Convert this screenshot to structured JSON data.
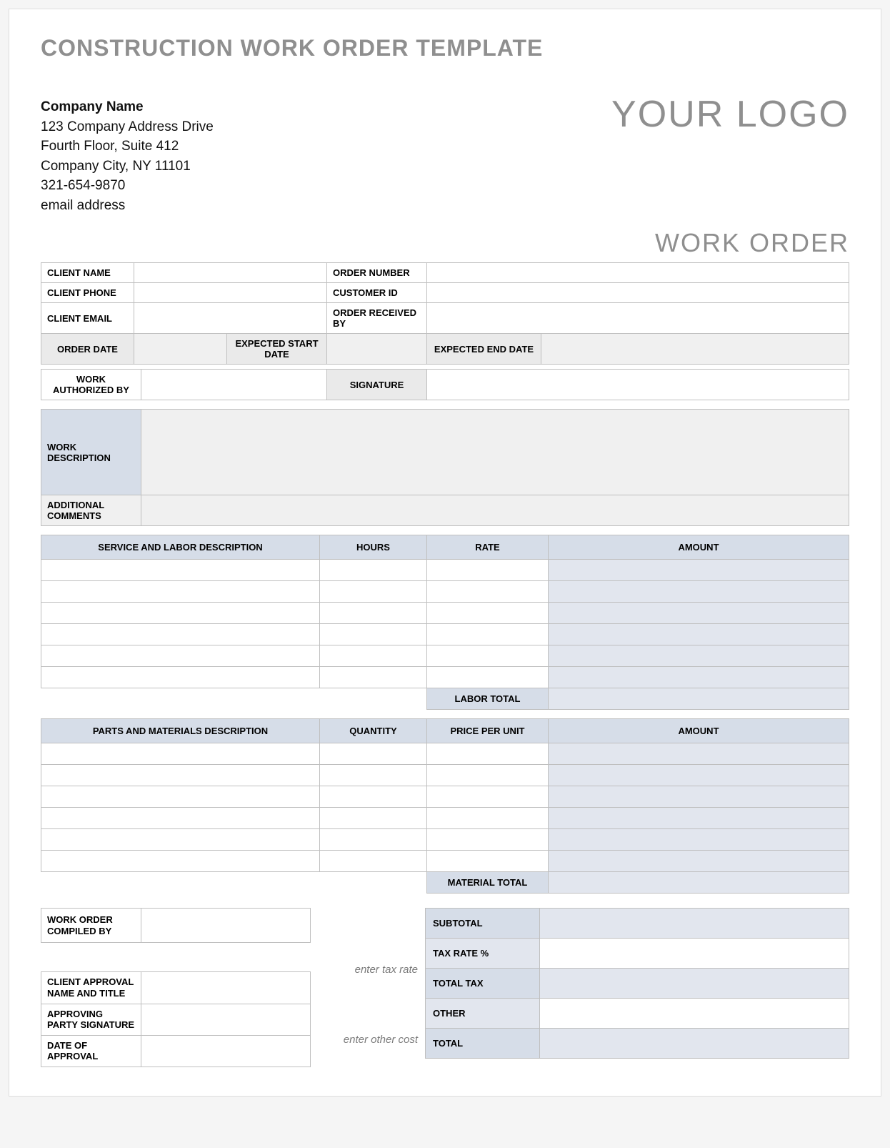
{
  "title": "CONSTRUCTION WORK ORDER TEMPLATE",
  "company": {
    "name": "Company Name",
    "addr1": "123 Company Address Drive",
    "addr2": "Fourth Floor, Suite 412",
    "addr3": "Company City, NY  11101",
    "phone": "321-654-9870",
    "email": "email address"
  },
  "logo": "YOUR LOGO",
  "work_order_heading": "WORK ORDER",
  "info": {
    "client_name_lbl": "CLIENT NAME",
    "client_phone_lbl": "CLIENT PHONE",
    "client_email_lbl": "CLIENT EMAIL",
    "order_number_lbl": "ORDER NUMBER",
    "customer_id_lbl": "CUSTOMER ID",
    "order_received_by_lbl": "ORDER RECEIVED BY",
    "order_date_lbl": "ORDER DATE",
    "expected_start_lbl": "EXPECTED START DATE",
    "expected_end_lbl": "EXPECTED END DATE",
    "work_auth_lbl": "WORK AUTHORIZED BY",
    "signature_lbl": "SIGNATURE",
    "work_desc_lbl": "WORK DESCRIPTION",
    "additional_comments_lbl": "ADDITIONAL COMMENTS"
  },
  "service": {
    "desc_hdr": "SERVICE AND LABOR DESCRIPTION",
    "hours_hdr": "HOURS",
    "rate_hdr": "RATE",
    "amount_hdr": "AMOUNT",
    "labor_total_lbl": "LABOR TOTAL"
  },
  "parts": {
    "desc_hdr": "PARTS AND MATERIALS DESCRIPTION",
    "qty_hdr": "QUANTITY",
    "price_hdr": "PRICE PER UNIT",
    "amount_hdr": "AMOUNT",
    "material_total_lbl": "MATERIAL TOTAL"
  },
  "compiled_by_lbl": "WORK ORDER COMPILED BY",
  "hints": {
    "tax_rate": "enter tax rate",
    "other_cost": "enter other cost"
  },
  "totals": {
    "subtotal_lbl": "SUBTOTAL",
    "tax_rate_lbl": "TAX RATE %",
    "total_tax_lbl": "TOTAL TAX",
    "other_lbl": "OTHER",
    "total_lbl": "TOTAL"
  },
  "approval": {
    "name_title_lbl": "CLIENT APPROVAL NAME AND TITLE",
    "signature_lbl": "APPROVING PARTY SIGNATURE",
    "date_lbl": "DATE OF APPROVAL"
  }
}
